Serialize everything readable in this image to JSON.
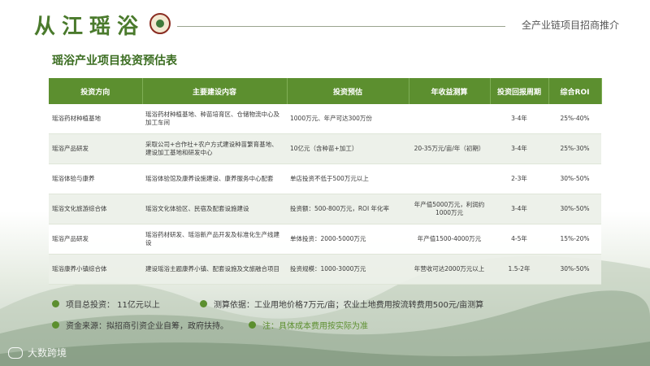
{
  "header": {
    "logo_text": "从江瑶浴",
    "right_title": "全产业链项目招商推介"
  },
  "section_title": "瑶浴产业项目投资预估表",
  "table": {
    "columns": [
      "投资方向",
      "主要建设内容",
      "投资预估",
      "年收益测算",
      "投资回报周期",
      "综合ROI"
    ],
    "rows": [
      [
        "瑶浴药材种植基地",
        "瑶浴药材种植基地、种苗培育区、仓储物流中心及加工车间",
        "1000万元、年产可达300万份",
        "",
        "3-4年",
        "25%-40%"
      ],
      [
        "瑶浴产品研发",
        "采取公司+合作社+农户方式建设种苗繁育基地、建设加工基地和研发中心",
        "10亿元（含种苗+加工）",
        "20-35万元/亩/年（初期）",
        "3-4年",
        "25%-30%"
      ],
      [
        "瑶浴体验与康养",
        "瑶浴体验馆及康养设施建设、康养服务中心配套",
        "单店投资不低于500万元以上",
        "",
        "2-3年",
        "30%-50%"
      ],
      [
        "瑶浴文化旅游综合体",
        "瑶浴文化体验区、民宿及配套设施建设",
        "投资额：500-800万元，ROI 年化率",
        "年产值5000万元，利润约1000万元",
        "3-4年",
        "30%-50%"
      ],
      [
        "瑶浴产品研发",
        "瑶浴药材研发、瑶浴新产品开发及标准化生产线建设",
        "单体投资：2000-5000万元",
        "年产值1500-4000万元",
        "4-5年",
        "15%-20%"
      ],
      [
        "瑶浴康养小镇综合体",
        "建设瑶浴主题康养小镇、配套设施及文旅融合项目",
        "投资规模：1000-3000万元",
        "年营收可达2000万元以上",
        "1.5-2年",
        "30%-50%"
      ]
    ]
  },
  "notes": {
    "total_investment": "项目总投资：     11亿元以上",
    "basis": "测算依据：工业用地价格7万元/亩；农业土地费用按流转费用500元/亩测算",
    "source": "资金来源：拟招商引资企业自筹，政府扶持。",
    "footnote": "注：具体成本费用按实际为准"
  },
  "watermark": "大数跨境",
  "colors": {
    "brand_green": "#5c8f2f",
    "title_green": "#3b6d21",
    "emblem_red": "#8a2c22"
  }
}
